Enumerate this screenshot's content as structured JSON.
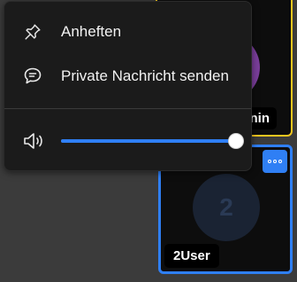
{
  "menu": {
    "items": [
      {
        "icon": "pin-icon",
        "label": "Anheften"
      },
      {
        "icon": "chat-bubble-icon",
        "label": "Private Nachricht senden"
      }
    ],
    "volume": {
      "icon": "speaker-icon",
      "level": 1.0
    }
  },
  "tiles": {
    "admin": {
      "name": "Admin",
      "visible_name": "nin",
      "border_color": "#f2c61f",
      "avatar_color": "#7a3e9a"
    },
    "user": {
      "name": "2User",
      "avatar_text": "2",
      "border_color": "#2f7ff5",
      "more_icon": "more-dots-icon"
    }
  },
  "colors": {
    "accent": "#2f7ff5",
    "menu_bg": "#1b1b1b",
    "background": "#3b3b3b"
  }
}
